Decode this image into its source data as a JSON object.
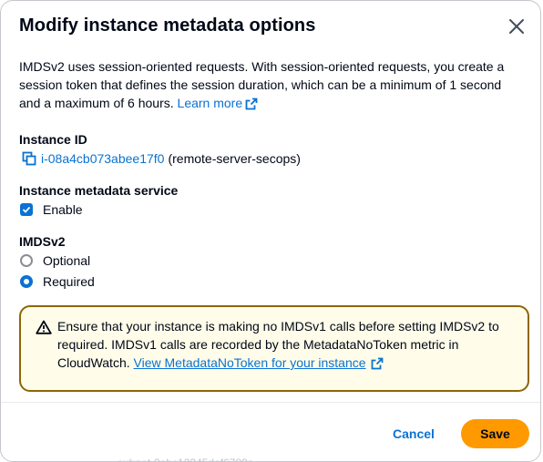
{
  "modal": {
    "title": "Modify instance metadata options",
    "description": "IMDSv2 uses session-oriented requests. With session-oriented requests, you create a session token that defines the session duration, which can be a minimum of 1 second and a maximum of 6 hours.",
    "learn_more": "Learn more"
  },
  "instance": {
    "label": "Instance ID",
    "id": "i-08a4cb073abee17f0",
    "name": "(remote-server-secops)"
  },
  "metadata_service": {
    "label": "Instance metadata service",
    "enable_label": "Enable",
    "enabled": true
  },
  "imdsv2": {
    "label": "IMDSv2",
    "options": [
      {
        "label": "Optional",
        "selected": false
      },
      {
        "label": "Required",
        "selected": true
      }
    ]
  },
  "warning": {
    "text": "Ensure that your instance is making no IMDSv1 calls before setting IMDSv2 to required. IMDSv1 calls are recorded by the MetadataNoToken metric in CloudWatch.",
    "link": "View MetadataNoToken for your instance"
  },
  "footer": {
    "cancel_label": "Cancel",
    "save_label": "Save"
  },
  "background_text": "subnet-0abc12345def6789a",
  "colors": {
    "link": "#0972d3",
    "primary_button": "#ff9900",
    "warning_bg": "#fffce9",
    "warning_border": "#8d6605"
  }
}
